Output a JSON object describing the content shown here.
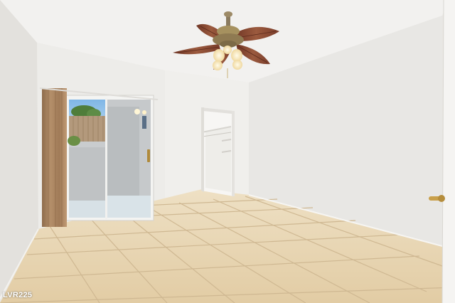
{
  "photo": {
    "watermark": "LVR225"
  },
  "colors": {
    "ceiling": "#f1f0ee",
    "wall_left": "#e4e2de",
    "wall_back": "#ecebe8",
    "wall_right": "#e7e6e3",
    "floor_tile": "#e6d3b0",
    "grout": "#cdb690",
    "curtain": "#a78461",
    "fan_blade": "#8b4a33"
  },
  "icons": [
    "ceiling-fan-icon",
    "door-handle-icon"
  ]
}
